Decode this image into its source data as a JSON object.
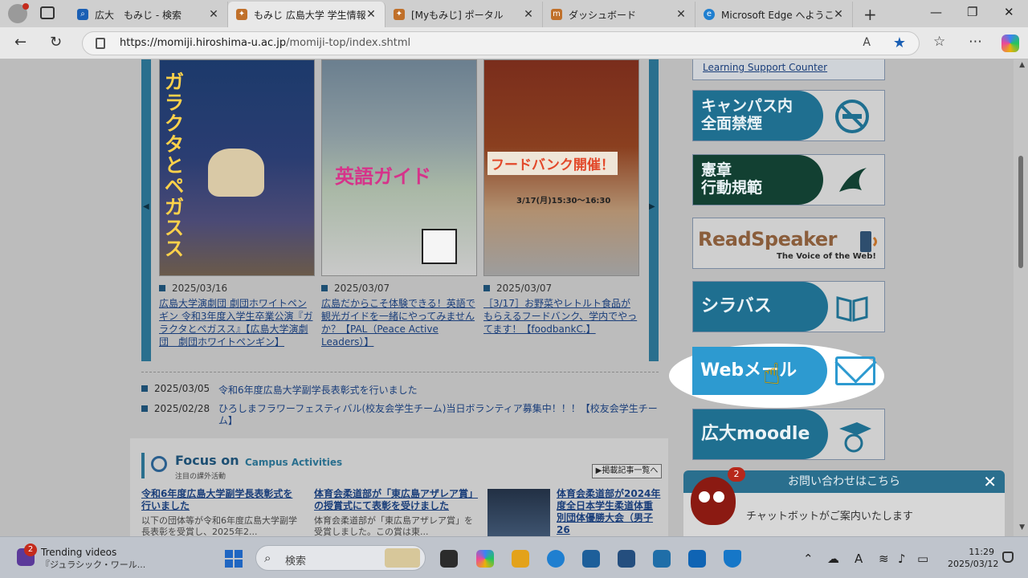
{
  "browser": {
    "tabs": [
      {
        "title": "広大　もみじ - 検索",
        "icon_color": "#1a5fb4",
        "icon": "search-icon"
      },
      {
        "title": "もみじ 広島大学 学生情報",
        "icon_color": "#c0702a",
        "icon": "maple-icon"
      },
      {
        "title": "[Myもみじ] ポータル",
        "icon_color": "#c0702a",
        "icon": "maple-icon"
      },
      {
        "title": "ダッシュボード",
        "icon_color": "#c0702a",
        "icon": "moodle-icon"
      },
      {
        "title": "Microsoft Edge へようこそ",
        "icon_color": "#1f7fd0",
        "icon": "edge-icon"
      }
    ],
    "url_domain": "https://momiji.hiroshima-u.ac.jp",
    "url_path": "/momiji-top/index.shtml",
    "read_aloud": "A",
    "new_tab": "+"
  },
  "carousel": {
    "slides": [
      {
        "date": "2025/03/16",
        "poster_text": "ガラクタとペガスス",
        "link": "広島大学演劇団 劇団ホワイトペンギン 令和3年度入学生卒業公演『ガラクタとペガスス』【広島大学演劇団　劇団ホワイトペンギン】"
      },
      {
        "date": "2025/03/07",
        "poster_text": "英語ガイド",
        "link": "広島だからこそ体験できる！英語で観光ガイドを一緒にやってみませんか？【PAL（Peace Active Leaders）】"
      },
      {
        "date": "2025/03/07",
        "poster_text": "フードバンク開催！",
        "poster_detail": "3/17(月)15:30～16:30",
        "link": "［3/17］お野菜やレトルト食品がもらえるフードバンク、学内でやってます！【foodbankC.】"
      }
    ]
  },
  "news": [
    {
      "date": "2025/03/05",
      "title": "令和6年度広島大学副学長表彰式を行いました"
    },
    {
      "date": "2025/02/28",
      "title": "ひろしまフラワーフェスティバル(校友会学生チーム)当日ボランティア募集中！！！【校友会学生チーム】"
    }
  ],
  "focus": {
    "title": "Focus on",
    "subtitle": "Campus Activities",
    "jp_subtitle": "注目の課外活動",
    "all_link": "▶掲載記事一覧へ",
    "articles": [
      {
        "title": "令和6年度広島大学副学長表彰式を行いました",
        "text": "以下の団体等が令和6年度広島大学副学長表彰を受賞し、2025年2..."
      },
      {
        "title": "体育会柔道部が「東広島アザレア賞」の授賞式にて表彰を受けました",
        "text": "体育会柔道部が「東広島アザレア賞」を受賞しました。この賞は東..."
      },
      {
        "title": "体育会柔道部が2024年度全日本学生柔道体重別団体優勝大会（男子26",
        "text": ""
      }
    ]
  },
  "sidebar": {
    "learning_support": "Learning Support Counter",
    "banners": [
      {
        "label": "キャンパス内\n全面禁煙",
        "icon": "no-smoking-icon"
      },
      {
        "label": "憲章\n行動規範",
        "icon": "phoenix-icon"
      },
      {
        "label": "ReadSpeaker",
        "sub": "The Voice of the Web!",
        "icon": "speaker-icon"
      },
      {
        "label": "シラバス",
        "icon": "book-icon"
      },
      {
        "label": "Webメール",
        "icon": "mail-icon"
      },
      {
        "label": "広大moodle",
        "icon": "graduate-icon"
      }
    ]
  },
  "chat": {
    "header": "お問い合わせはこちら",
    "body": "チャットボットがご案内いたします",
    "badge": "2",
    "close": "✕"
  },
  "taskbar": {
    "trending_title": "Trending videos",
    "trending_sub": "『ジュラシック・ワール...",
    "trending_badge": "2",
    "search_label": "検索",
    "time": "11:29",
    "date": "2025/03/12"
  }
}
